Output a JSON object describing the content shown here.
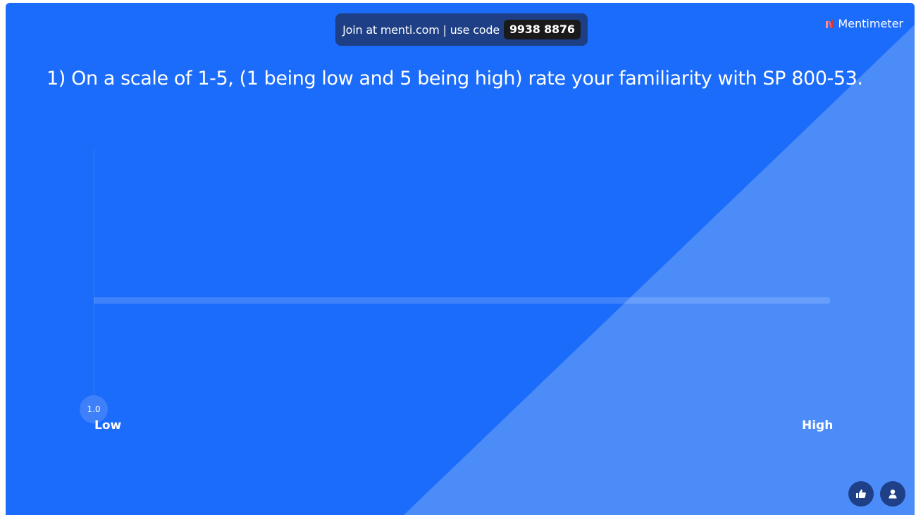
{
  "join_banner": {
    "text": "Join at menti.com | use code",
    "code": "9938 8876"
  },
  "brand": {
    "name": "Mentimeter",
    "logo_icon": "mentimeter-logo-icon"
  },
  "question": {
    "text": "1) On a scale of 1-5, (1 being low and 5 being high) rate your familiarity with SP 800-53."
  },
  "scale": {
    "min_label": "Low",
    "max_label": "High",
    "average_value": "1.0"
  },
  "controls": {
    "like_icon": "thumbs-up-icon",
    "audience_icon": "person-icon"
  },
  "colors": {
    "background": "#1b6cfb",
    "diagonal_overlay": "#4b8cf9",
    "banner": "#1e3f86",
    "code_pill": "#1a1a1a"
  }
}
